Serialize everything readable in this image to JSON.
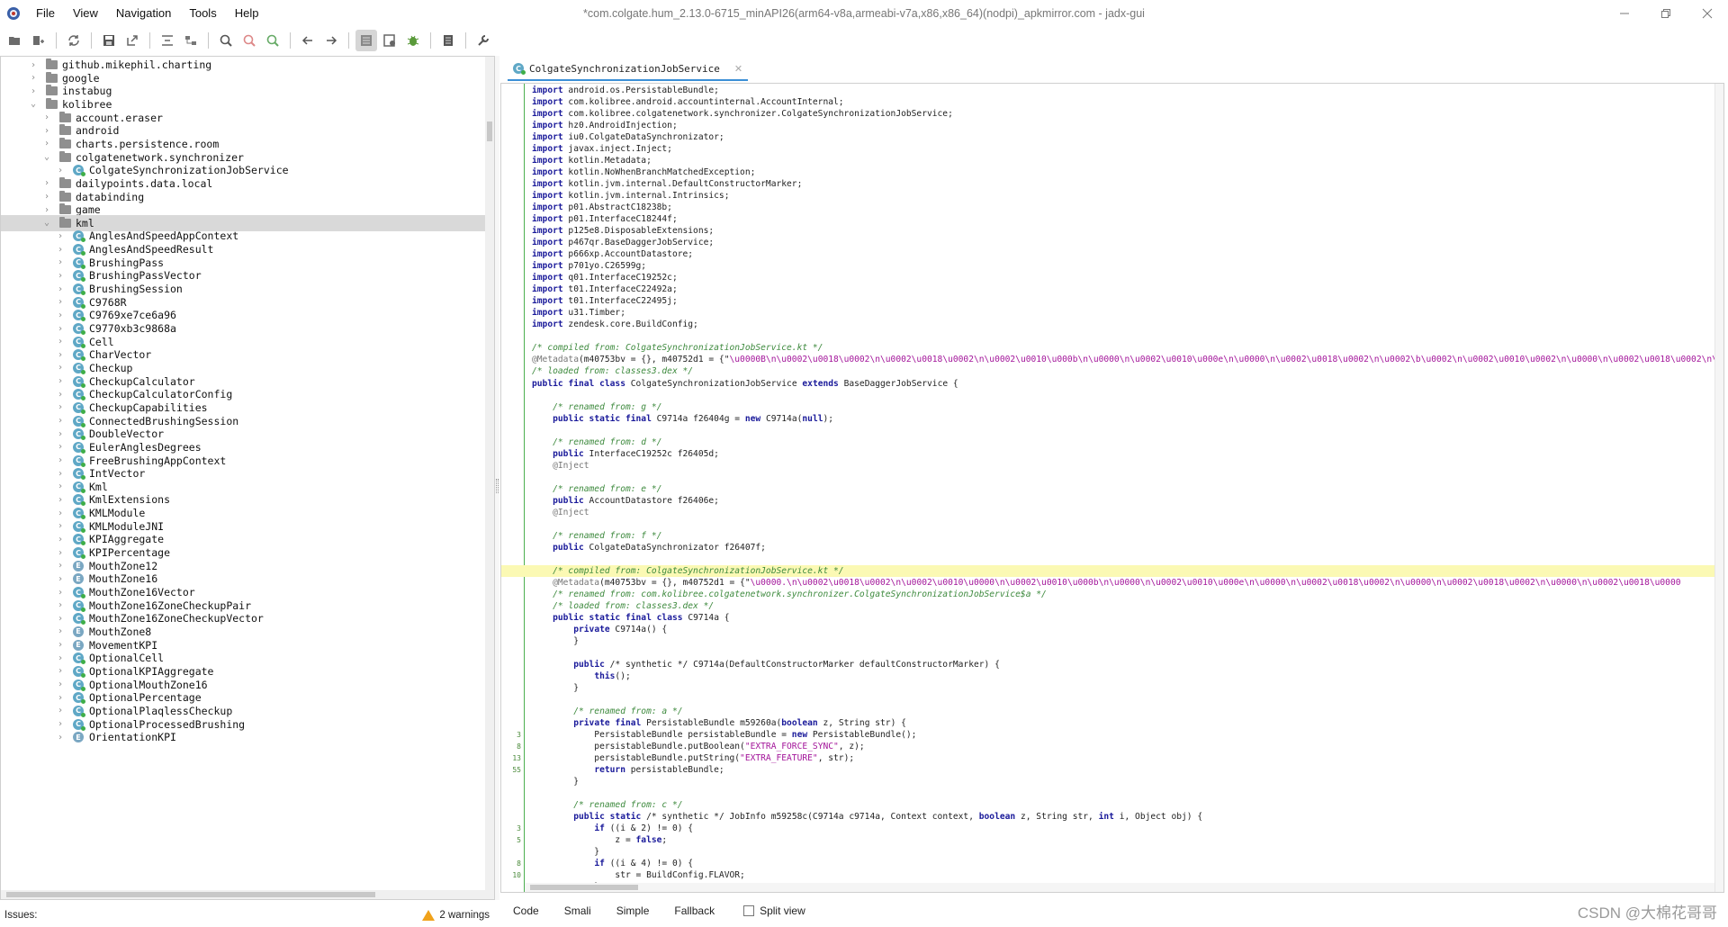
{
  "window": {
    "title": "*com.colgate.hum_2.13.0-6715_minAPI26(arm64-v8a,armeabi-v7a,x86,x86_64)(nodpi)_apkmirror.com - jadx-gui",
    "controls": [
      "minimize-icon",
      "restore-icon",
      "close-icon"
    ]
  },
  "menu": [
    "File",
    "View",
    "Navigation",
    "Tools",
    "Help"
  ],
  "toolbar": {
    "groups": [
      [
        "open-file-icon",
        "add-files-icon"
      ],
      [
        "sync-icon",
        "save-icon",
        "export-icon"
      ],
      [
        "flatten-packages-icon",
        "sync-tree-icon"
      ],
      [
        "search-icon",
        "search-usage-icon",
        "find-class-icon"
      ],
      [
        "back-icon",
        "forward-icon"
      ],
      [
        "quark-icon",
        "decompile-all-icon",
        "debug-icon"
      ],
      [
        "log-icon"
      ],
      [
        "preferences-icon"
      ]
    ],
    "active": "quark-icon"
  },
  "tree": {
    "rows": [
      {
        "label": "github.mikephil.charting",
        "level": 2,
        "type": "package",
        "expanded": false
      },
      {
        "label": "google",
        "level": 2,
        "type": "package",
        "expanded": false
      },
      {
        "label": "instabug",
        "level": 2,
        "type": "package",
        "expanded": false
      },
      {
        "label": "kolibree",
        "level": 2,
        "type": "package",
        "expanded": true
      },
      {
        "label": "account.eraser",
        "level": 3,
        "type": "package",
        "expanded": false
      },
      {
        "label": "android",
        "level": 3,
        "type": "package",
        "expanded": false
      },
      {
        "label": "charts.persistence.room",
        "level": 3,
        "type": "package",
        "expanded": false
      },
      {
        "label": "colgatenetwork.synchronizer",
        "level": 3,
        "type": "package",
        "expanded": true
      },
      {
        "label": "ColgateSynchronizationJobService",
        "level": 4,
        "type": "class",
        "expanded": false
      },
      {
        "label": "dailypoints.data.local",
        "level": 3,
        "type": "package",
        "expanded": false
      },
      {
        "label": "databinding",
        "level": 3,
        "type": "package",
        "expanded": false
      },
      {
        "label": "game",
        "level": 3,
        "type": "package",
        "expanded": false
      },
      {
        "label": "kml",
        "level": 3,
        "type": "package",
        "expanded": true,
        "selected": true
      },
      {
        "label": "AnglesAndSpeedAppContext",
        "level": 4,
        "type": "class"
      },
      {
        "label": "AnglesAndSpeedResult",
        "level": 4,
        "type": "class"
      },
      {
        "label": "BrushingPass",
        "level": 4,
        "type": "class"
      },
      {
        "label": "BrushingPassVector",
        "level": 4,
        "type": "class"
      },
      {
        "label": "BrushingSession",
        "level": 4,
        "type": "class"
      },
      {
        "label": "C9768R",
        "level": 4,
        "type": "class"
      },
      {
        "label": "C9769xe7ce6a96",
        "level": 4,
        "type": "class"
      },
      {
        "label": "C9770xb3c9868a",
        "level": 4,
        "type": "class"
      },
      {
        "label": "Cell",
        "level": 4,
        "type": "class"
      },
      {
        "label": "CharVector",
        "level": 4,
        "type": "class"
      },
      {
        "label": "Checkup",
        "level": 4,
        "type": "class"
      },
      {
        "label": "CheckupCalculator",
        "level": 4,
        "type": "class"
      },
      {
        "label": "CheckupCalculatorConfig",
        "level": 4,
        "type": "class"
      },
      {
        "label": "CheckupCapabilities",
        "level": 4,
        "type": "class"
      },
      {
        "label": "ConnectedBrushingSession",
        "level": 4,
        "type": "class"
      },
      {
        "label": "DoubleVector",
        "level": 4,
        "type": "class"
      },
      {
        "label": "EulerAnglesDegrees",
        "level": 4,
        "type": "class"
      },
      {
        "label": "FreeBrushingAppContext",
        "level": 4,
        "type": "class"
      },
      {
        "label": "IntVector",
        "level": 4,
        "type": "class"
      },
      {
        "label": "Kml",
        "level": 4,
        "type": "class"
      },
      {
        "label": "KmlExtensions",
        "level": 4,
        "type": "class"
      },
      {
        "label": "KMLModule",
        "level": 4,
        "type": "class"
      },
      {
        "label": "KMLModuleJNI",
        "level": 4,
        "type": "class"
      },
      {
        "label": "KPIAggregate",
        "level": 4,
        "type": "class"
      },
      {
        "label": "KPIPercentage",
        "level": 4,
        "type": "class"
      },
      {
        "label": "MouthZone12",
        "level": 4,
        "type": "enum"
      },
      {
        "label": "MouthZone16",
        "level": 4,
        "type": "enum"
      },
      {
        "label": "MouthZone16Vector",
        "level": 4,
        "type": "class"
      },
      {
        "label": "MouthZone16ZoneCheckupPair",
        "level": 4,
        "type": "class"
      },
      {
        "label": "MouthZone16ZoneCheckupVector",
        "level": 4,
        "type": "class"
      },
      {
        "label": "MouthZone8",
        "level": 4,
        "type": "enum"
      },
      {
        "label": "MovementKPI",
        "level": 4,
        "type": "enum"
      },
      {
        "label": "OptionalCell",
        "level": 4,
        "type": "class"
      },
      {
        "label": "OptionalKPIAggregate",
        "level": 4,
        "type": "class"
      },
      {
        "label": "OptionalMouthZone16",
        "level": 4,
        "type": "class"
      },
      {
        "label": "OptionalPercentage",
        "level": 4,
        "type": "class"
      },
      {
        "label": "OptionalPlaqlessCheckup",
        "level": 4,
        "type": "class"
      },
      {
        "label": "OptionalProcessedBrushing",
        "level": 4,
        "type": "class"
      },
      {
        "label": "OrientationKPI",
        "level": 4,
        "type": "enum"
      }
    ]
  },
  "editor": {
    "tab_label": "ColgateSynchronizationJobService",
    "highlight_color": "#fbf9b4",
    "lines": [
      {
        "n": "",
        "t": "import android.os.PersistableBundle;"
      },
      {
        "n": "",
        "t": "import com.kolibree.android.accountinternal.AccountInternal;"
      },
      {
        "n": "",
        "t": "import com.kolibree.colgatenetwork.synchronizer.ColgateSynchronizationJobService;"
      },
      {
        "n": "",
        "t": "import hz0.AndroidInjection;"
      },
      {
        "n": "",
        "t": "import iu0.ColgateDataSynchronizator;"
      },
      {
        "n": "",
        "t": "import javax.inject.Inject;"
      },
      {
        "n": "",
        "t": "import kotlin.Metadata;"
      },
      {
        "n": "",
        "t": "import kotlin.NoWhenBranchMatchedException;"
      },
      {
        "n": "",
        "t": "import kotlin.jvm.internal.DefaultConstructorMarker;"
      },
      {
        "n": "",
        "t": "import kotlin.jvm.internal.Intrinsics;"
      },
      {
        "n": "",
        "t": "import p01.AbstractC18238b;"
      },
      {
        "n": "",
        "t": "import p01.InterfaceC18244f;"
      },
      {
        "n": "",
        "t": "import p125e8.DisposableExtensions;"
      },
      {
        "n": "",
        "t": "import p467qr.BaseDaggerJobService;"
      },
      {
        "n": "",
        "t": "import p666xp.AccountDatastore;"
      },
      {
        "n": "",
        "t": "import p701yo.C26599g;"
      },
      {
        "n": "",
        "t": "import q01.InterfaceC19252c;"
      },
      {
        "n": "",
        "t": "import t01.InterfaceC22492a;"
      },
      {
        "n": "",
        "t": "import t01.InterfaceC22495j;"
      },
      {
        "n": "",
        "t": "import u31.Timber;"
      },
      {
        "n": "",
        "t": "import zendesk.core.BuildConfig;"
      },
      {
        "n": "",
        "t": ""
      },
      {
        "n": "",
        "t": "/* compiled from: ColgateSynchronizationJobService.kt */"
      },
      {
        "n": "",
        "t": "@Metadata(m40753bv = {}, m40752d1 = {\"\\u0000B\\n\\u0002\\u0018\\u0002\\n\\u0002\\u0018\\u0002\\n\\u0002\\u0010\\u000b\\n\\u0000\\n\\u0002\\u0010\\u000e\\n\\u0000\\n\\u0002\\u0018\\u0002\\n\\u0002\\b\\u0002\\n\\u0002\\u0010\\u0002\\n\\u0000\\n\\u0002\\u0018\\u0002\\n\\u0002\\u0018\\u0002\\n\\u0002\\u0018\\u0002\\n\\u0002\\u0018"
      },
      {
        "n": "",
        "t": "/* loaded from: classes3.dex */"
      },
      {
        "n": "",
        "t": "public final class ColgateSynchronizationJobService extends BaseDaggerJobService {"
      },
      {
        "n": "",
        "t": ""
      },
      {
        "n": "",
        "t": "    /* renamed from: g */"
      },
      {
        "n": "",
        "t": "    public static final C9714a f26404g = new C9714a(null);"
      },
      {
        "n": "",
        "t": ""
      },
      {
        "n": "",
        "t": "    /* renamed from: d */"
      },
      {
        "n": "",
        "t": "    public InterfaceC19252c f26405d;"
      },
      {
        "n": "",
        "t": "    @Inject"
      },
      {
        "n": "",
        "t": ""
      },
      {
        "n": "",
        "t": "    /* renamed from: e */"
      },
      {
        "n": "",
        "t": "    public AccountDatastore f26406e;"
      },
      {
        "n": "",
        "t": "    @Inject"
      },
      {
        "n": "",
        "t": ""
      },
      {
        "n": "",
        "t": "    /* renamed from: f */"
      },
      {
        "n": "",
        "t": "    public ColgateDataSynchronizator f26407f;"
      },
      {
        "n": "",
        "t": ""
      },
      {
        "n": "",
        "t": "    /* compiled from: ColgateSynchronizationJobService.kt */",
        "hl": true
      },
      {
        "n": "",
        "t": "    @Metadata(m40753bv = {}, m40752d1 = {\"\\u0000.\\n\\u0002\\u0018\\u0002\\n\\u0002\\u0010\\u0000\\n\\u0002\\u0010\\u000b\\n\\u0000\\n\\u0002\\u0010\\u000e\\n\\u0000\\n\\u0002\\u0018\\u0002\\n\\u0000\\n\\u0002\\u0018\\u0002\\n\\u0000\\n\\u0002\\u0018\\u0000"
      },
      {
        "n": "",
        "t": "    /* renamed from: com.kolibree.colgatenetwork.synchronizer.ColgateSynchronizationJobService$a */"
      },
      {
        "n": "",
        "t": "    /* loaded from: classes3.dex */"
      },
      {
        "n": "",
        "t": "    public static final class C9714a {"
      },
      {
        "n": "",
        "t": "        private C9714a() {"
      },
      {
        "n": "",
        "t": "        }"
      },
      {
        "n": "",
        "t": ""
      },
      {
        "n": "",
        "t": "        public /* synthetic */ C9714a(DefaultConstructorMarker defaultConstructorMarker) {"
      },
      {
        "n": "",
        "t": "            this();"
      },
      {
        "n": "",
        "t": "        }"
      },
      {
        "n": "",
        "t": ""
      },
      {
        "n": "",
        "t": "        /* renamed from: a */"
      },
      {
        "n": "",
        "t": "        private final PersistableBundle m59260a(boolean z, String str) {"
      },
      {
        "n": "3",
        "t": "            PersistableBundle persistableBundle = new PersistableBundle();"
      },
      {
        "n": "8",
        "t": "            persistableBundle.putBoolean(\"EXTRA_FORCE_SYNC\", z);"
      },
      {
        "n": "13",
        "t": "            persistableBundle.putString(\"EXTRA_FEATURE\", str);"
      },
      {
        "n": "55",
        "t": "            return persistableBundle;"
      },
      {
        "n": "",
        "t": "        }"
      },
      {
        "n": "",
        "t": ""
      },
      {
        "n": "",
        "t": "        /* renamed from: c */"
      },
      {
        "n": "",
        "t": "        public static /* synthetic */ JobInfo m59258c(C9714a c9714a, Context context, boolean z, String str, int i, Object obj) {"
      },
      {
        "n": "3",
        "t": "            if ((i & 2) != 0) {"
      },
      {
        "n": "5",
        "t": "                z = false;"
      },
      {
        "n": "",
        "t": "            }"
      },
      {
        "n": "8",
        "t": "            if ((i & 4) != 0) {"
      },
      {
        "n": "10",
        "t": "                str = BuildConfig.FLAVOR;"
      },
      {
        "n": "",
        "t": "            }"
      }
    ]
  },
  "bottom": {
    "issues_label": "Issues:",
    "warnings_label": "2 warnings",
    "code_tabs": [
      "Code",
      "Smali",
      "Simple",
      "Fallback"
    ],
    "split_view_label": "Split view",
    "watermark": "CSDN @大棉花哥哥"
  }
}
